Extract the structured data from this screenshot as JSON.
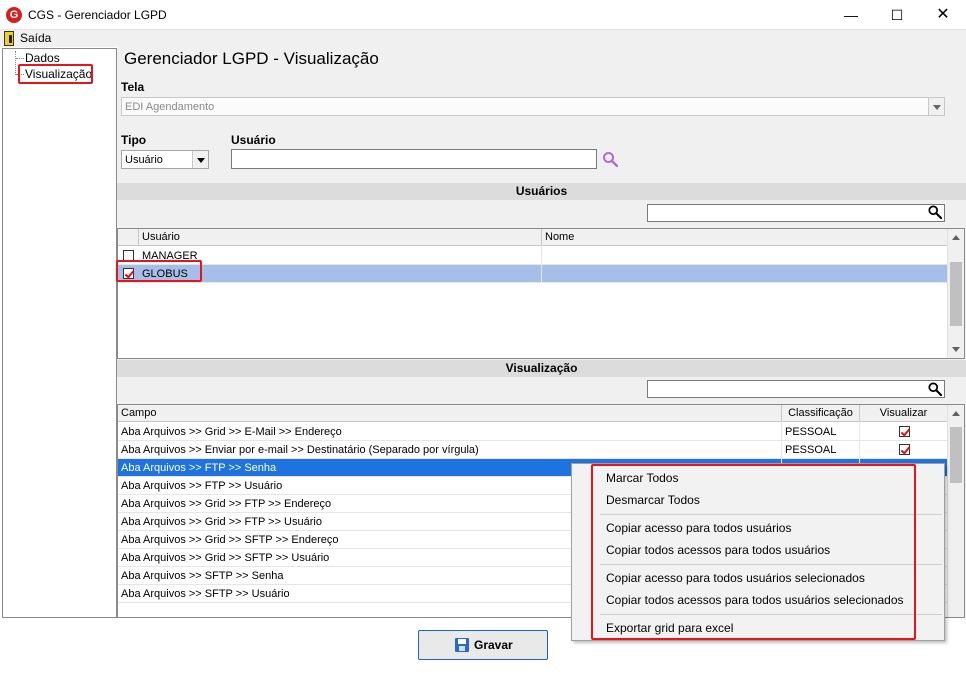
{
  "window": {
    "icon_letter": "G",
    "title": "CGS - Gerenciador LGPD",
    "minimize": "—",
    "maximize": "☐",
    "close": "✕"
  },
  "menu": {
    "exit": "Saída"
  },
  "tree": {
    "items": [
      "Dados",
      "Visualização"
    ]
  },
  "page": {
    "title": "Gerenciador LGPD - Visualização"
  },
  "form": {
    "tela_label": "Tela",
    "tela_value": "EDI Agendamento",
    "tipo_label": "Tipo",
    "tipo_value": "Usuário",
    "usuario_label": "Usuário",
    "usuario_value": ""
  },
  "users_section": {
    "title": "Usuários",
    "filter_value": "",
    "columns": [
      "Usuário",
      "Nome"
    ],
    "rows": [
      {
        "checked": false,
        "usuario": "MANAGER",
        "nome": ""
      },
      {
        "checked": true,
        "usuario": "GLOBUS",
        "nome": ""
      }
    ]
  },
  "view_section": {
    "title": "Visualização",
    "filter_value": "",
    "columns": [
      "Campo",
      "Classificação",
      "Visualizar"
    ],
    "rows": [
      {
        "campo": "Aba Arquivos >> Grid >> E-Mail >> Endereço",
        "classificacao": "PESSOAL",
        "visualizar": true
      },
      {
        "campo": "Aba Arquivos >> Enviar por e-mail >> Destinatário (Separado por vírgula)",
        "classificacao": "PESSOAL",
        "visualizar": true
      },
      {
        "campo": "Aba Arquivos >> FTP >> Senha",
        "classificacao": "",
        "visualizar": false
      },
      {
        "campo": "Aba Arquivos >> FTP >> Usuário",
        "classificacao": "",
        "visualizar": false
      },
      {
        "campo": "Aba Arquivos >> Grid >> FTP >>  Endereço",
        "classificacao": "",
        "visualizar": false
      },
      {
        "campo": "Aba Arquivos >> Grid >> FTP >> Usuário",
        "classificacao": "",
        "visualizar": false
      },
      {
        "campo": "Aba Arquivos >> Grid >> SFTP >> Endereço",
        "classificacao": "",
        "visualizar": false
      },
      {
        "campo": "Aba Arquivos >> Grid >> SFTP >> Usuário",
        "classificacao": "",
        "visualizar": false
      },
      {
        "campo": "Aba Arquivos >> SFTP >> Senha",
        "classificacao": "",
        "visualizar": false
      },
      {
        "campo": "Aba Arquivos >> SFTP >> Usuário",
        "classificacao": "",
        "visualizar": false
      }
    ]
  },
  "context_menu": {
    "items": [
      "Marcar Todos",
      "Desmarcar Todos",
      "Copiar acesso para todos usuários",
      "Copiar todos acessos para todos usuários",
      "Copiar acesso para todos usuários selecionados",
      "Copiar todos acessos para todos usuários selecionados",
      "Exportar grid para excel"
    ]
  },
  "footer": {
    "save_label": "Gravar"
  },
  "colors": {
    "highlight_red": "#e8141b",
    "selection_blue": "#1e73e0",
    "selected_row": "#a7bfe8",
    "brand_red": "#d81e1e"
  }
}
